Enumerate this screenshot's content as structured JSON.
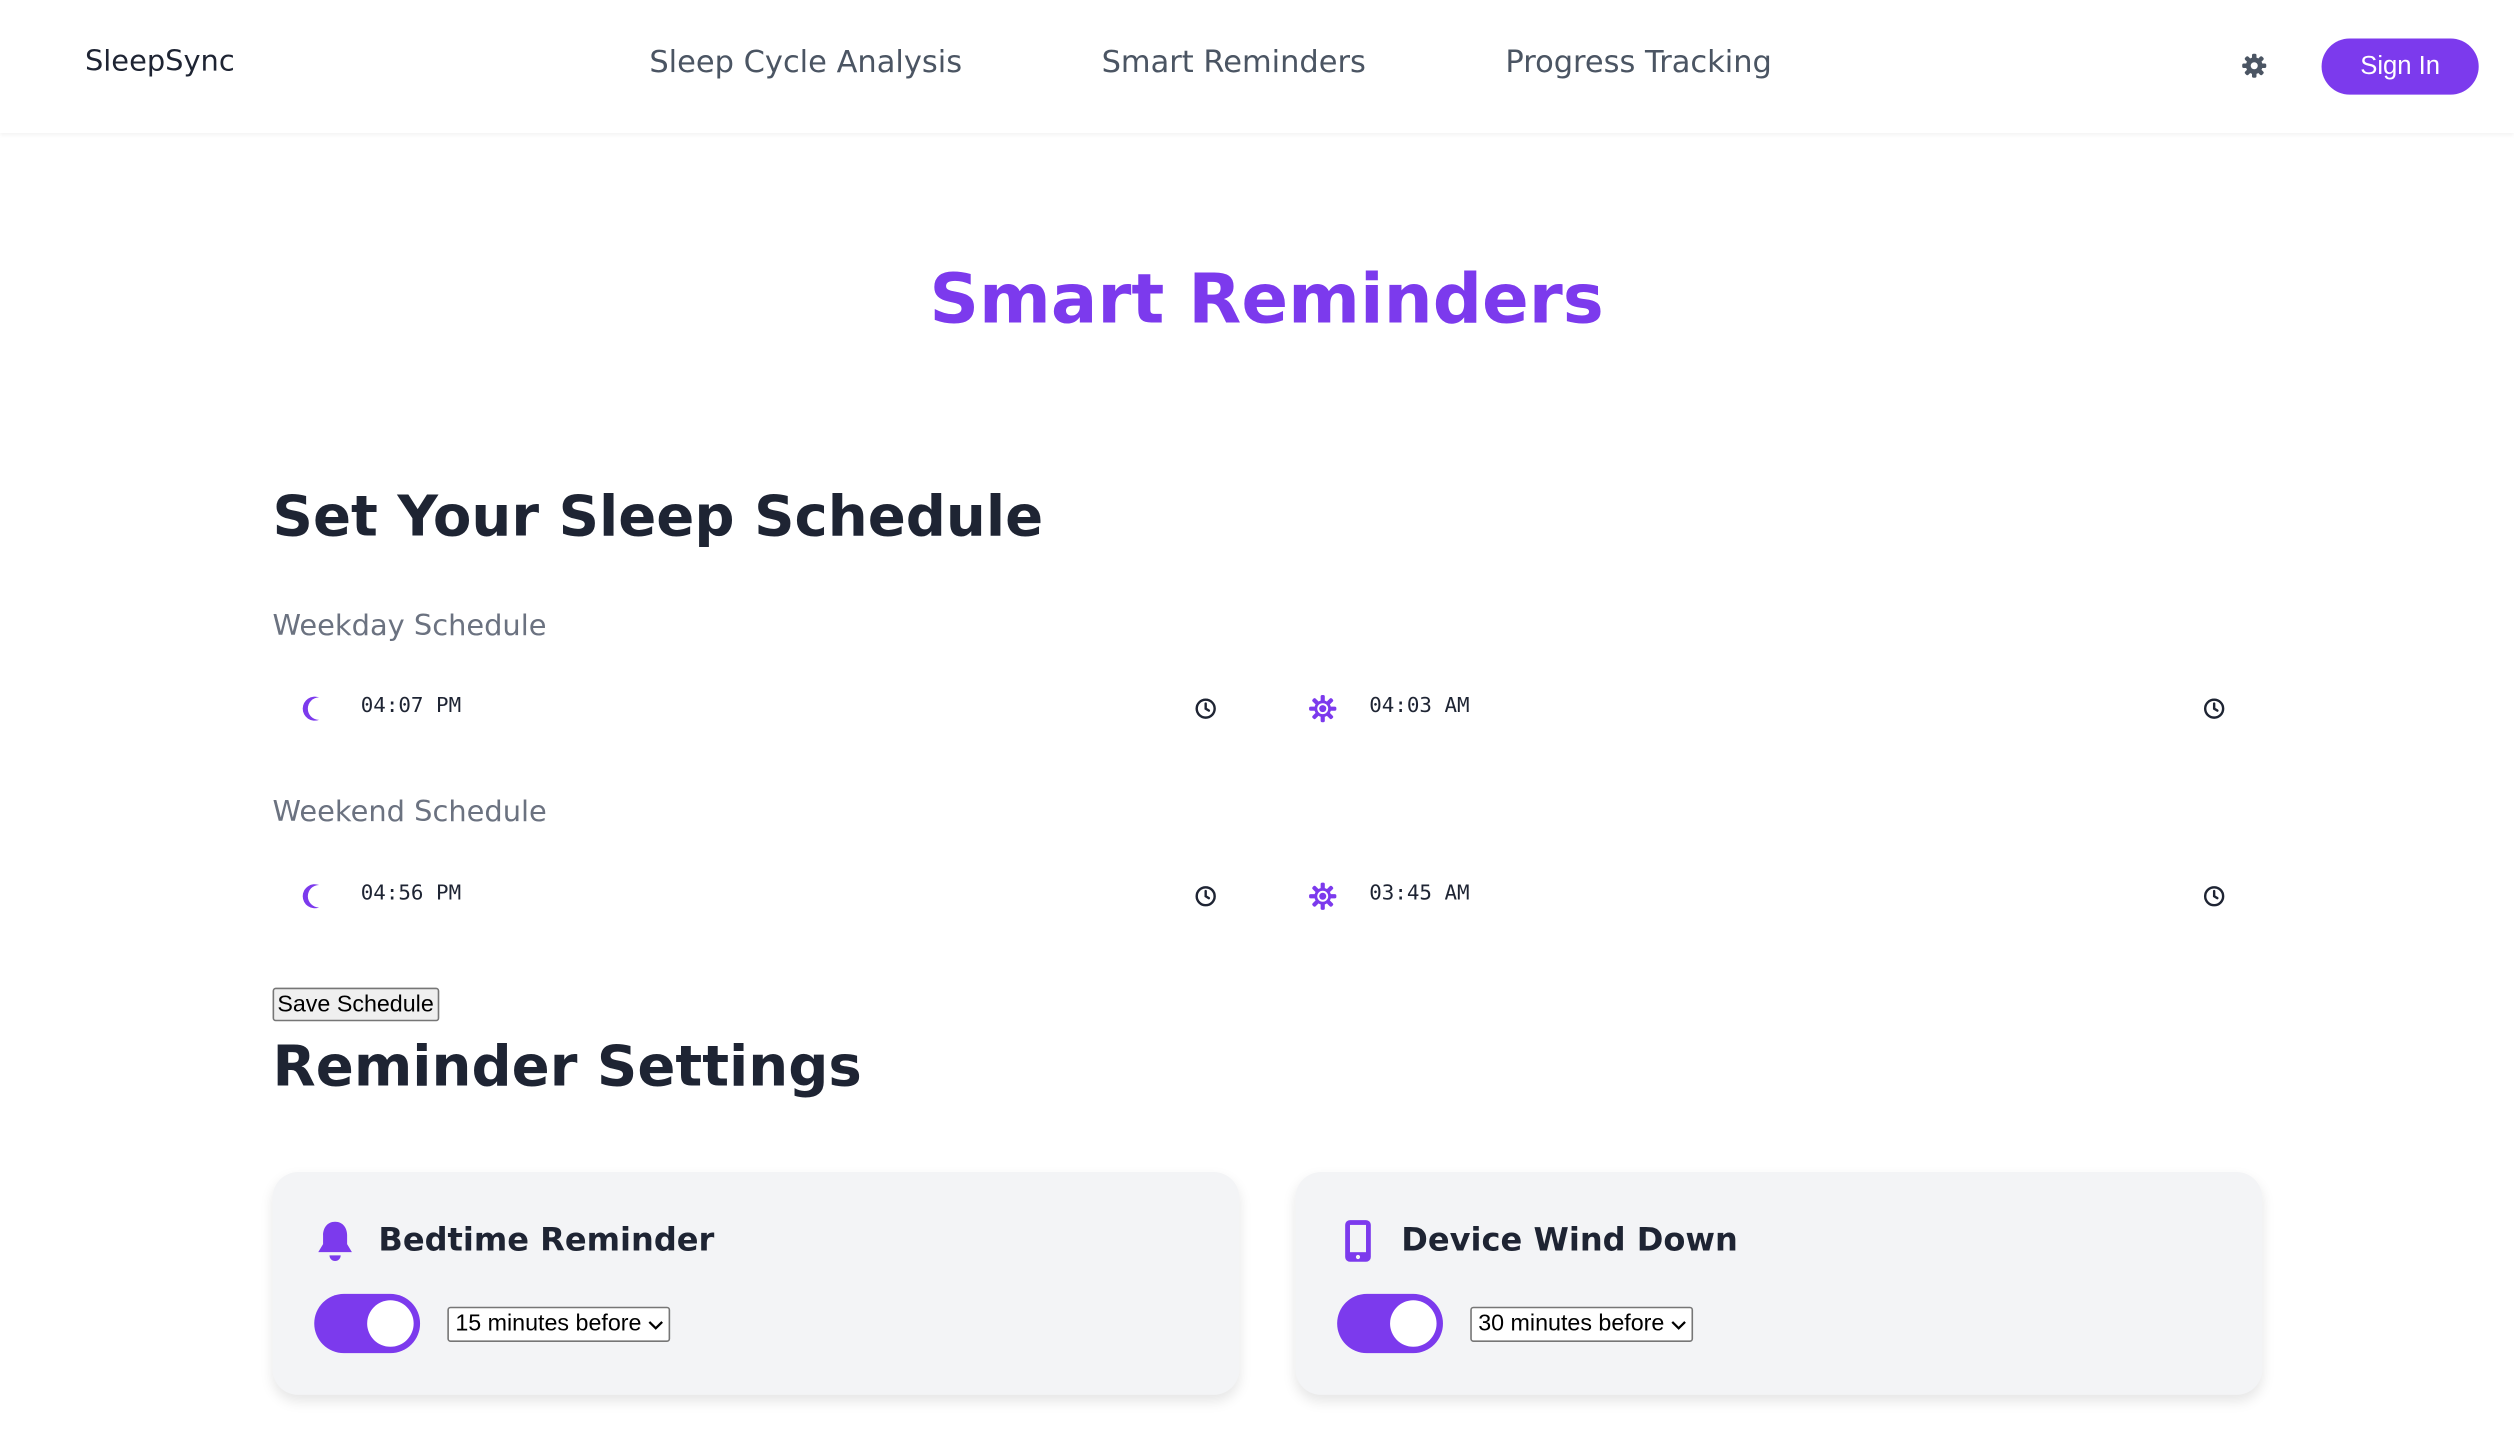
{
  "nav": {
    "logo_text": "SleepSync",
    "links": [
      "Sleep Cycle Analysis",
      "Smart Reminders",
      "Progress Tracking"
    ],
    "sign_in_label": "Sign In"
  },
  "page_title": "Smart Reminders",
  "schedule": {
    "title": "Set Your Sleep Schedule",
    "weekday": {
      "label": "Weekday Schedule",
      "bedtime": "04:07 PM",
      "wake": "04:03 AM"
    },
    "weekend": {
      "label": "Weekend Schedule",
      "bedtime": "04:56 PM",
      "wake": "03:45 AM"
    },
    "save_label": "Save Schedule"
  },
  "reminders": {
    "title": "Reminder Settings",
    "cards": [
      {
        "title": "Bedtime Reminder",
        "icon": "bell-icon",
        "enabled": true,
        "selected": "15 minutes before"
      },
      {
        "title": "Device Wind Down",
        "icon": "phone-icon",
        "enabled": true,
        "selected": "30 minutes before"
      }
    ]
  },
  "colors": {
    "accent": "#7c3aed",
    "text": "#1e2433",
    "muted": "#6b7280",
    "card_bg": "#f3f4f6"
  }
}
